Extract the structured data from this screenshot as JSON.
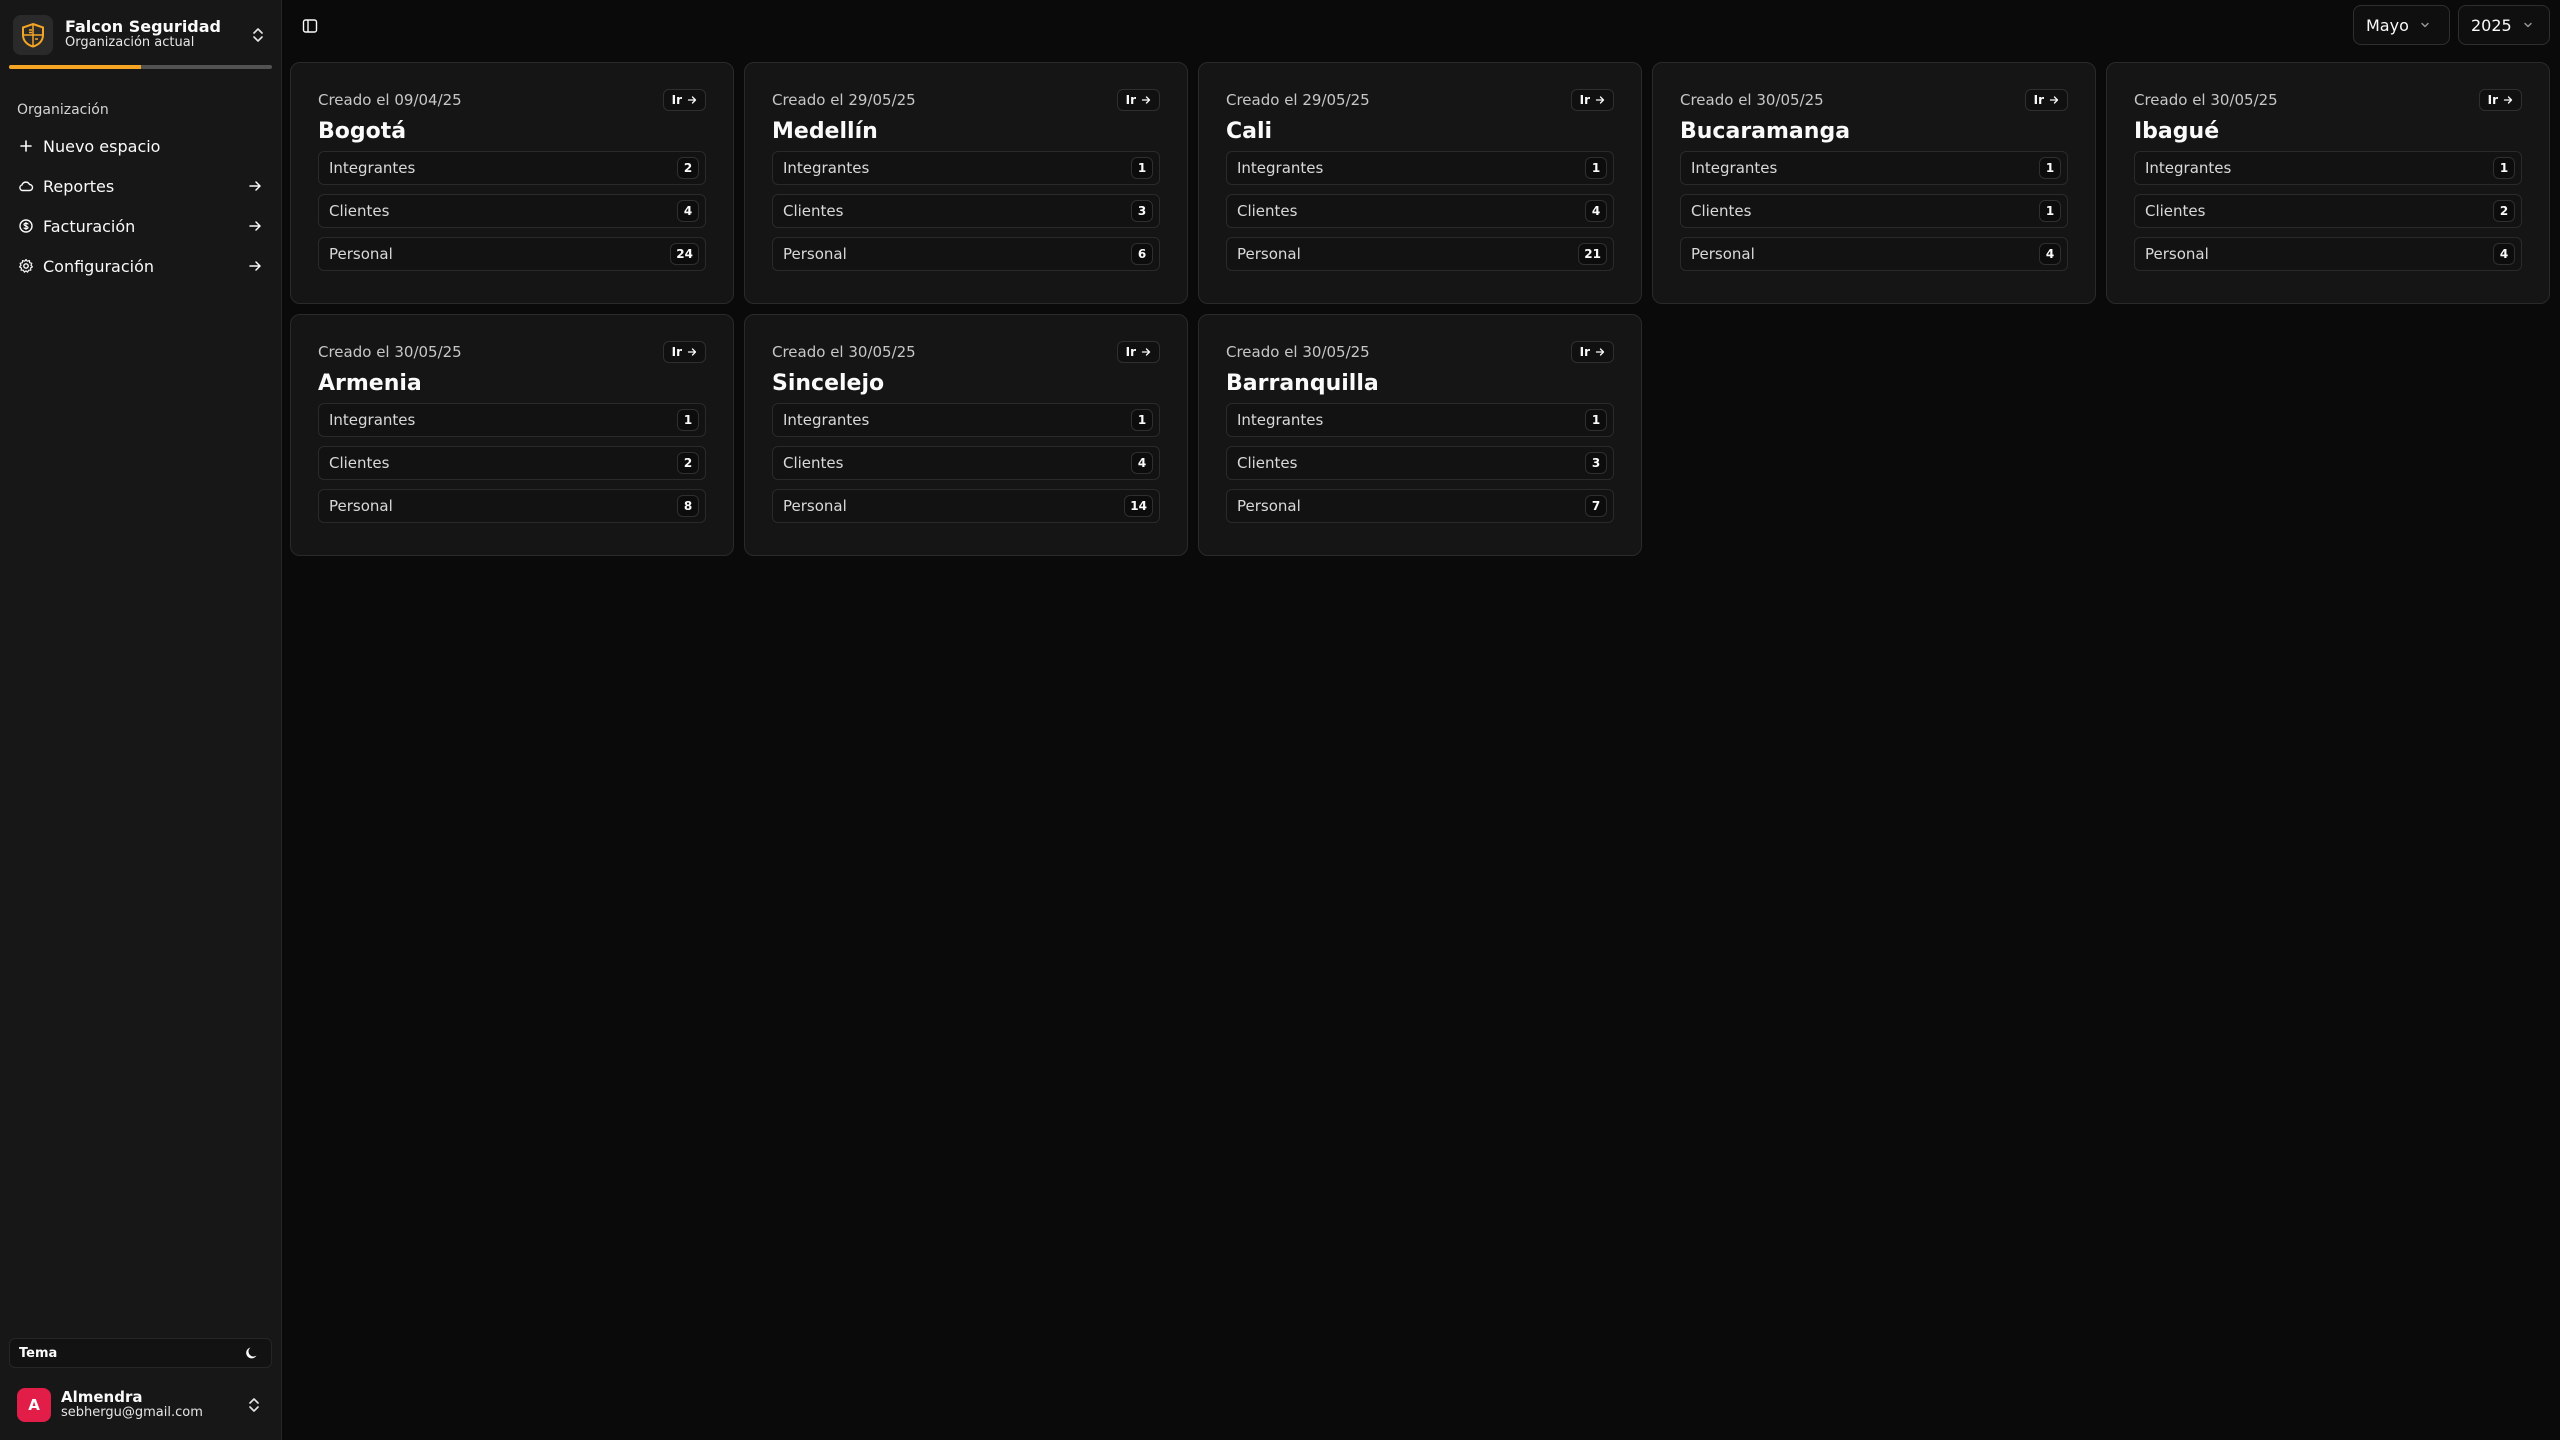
{
  "org": {
    "name": "Falcon Seguridad",
    "subtitle": "Organización actual",
    "progress": 0.5
  },
  "sidebar": {
    "section_label": "Organización",
    "items": [
      {
        "label": "Nuevo espacio",
        "icon": "plus-icon",
        "arrow": false
      },
      {
        "label": "Reportes",
        "icon": "cloud-icon",
        "arrow": true
      },
      {
        "label": "Facturación",
        "icon": "dollar-circle-icon",
        "arrow": true
      },
      {
        "label": "Configuración",
        "icon": "gear-icon",
        "arrow": true
      }
    ],
    "theme_label": "Tema",
    "theme_icon": "moon-icon"
  },
  "user": {
    "initial": "A",
    "name": "Almendra",
    "email": "sebhergu@gmail.com",
    "avatar_color": "#e11d48"
  },
  "filters": {
    "month": "Mayo",
    "year": "2025"
  },
  "accent": "#f5a524",
  "card_common": {
    "go_label": "Ir",
    "stat_labels": [
      "Integrantes",
      "Clientes",
      "Personal"
    ]
  },
  "cards": [
    {
      "created": "Creado el 09/04/25",
      "title": "Bogotá",
      "stats": [
        "2",
        "4",
        "24"
      ]
    },
    {
      "created": "Creado el 29/05/25",
      "title": "Medellín",
      "stats": [
        "1",
        "3",
        "6"
      ]
    },
    {
      "created": "Creado el 29/05/25",
      "title": "Cali",
      "stats": [
        "1",
        "4",
        "21"
      ]
    },
    {
      "created": "Creado el 30/05/25",
      "title": "Bucaramanga",
      "stats": [
        "1",
        "1",
        "4"
      ]
    },
    {
      "created": "Creado el 30/05/25",
      "title": "Ibagué",
      "stats": [
        "1",
        "2",
        "4"
      ]
    },
    {
      "created": "Creado el 30/05/25",
      "title": "Armenia",
      "stats": [
        "1",
        "2",
        "8"
      ]
    },
    {
      "created": "Creado el 30/05/25",
      "title": "Sincelejo",
      "stats": [
        "1",
        "4",
        "14"
      ]
    },
    {
      "created": "Creado el 30/05/25",
      "title": "Barranquilla",
      "stats": [
        "1",
        "3",
        "7"
      ]
    }
  ]
}
